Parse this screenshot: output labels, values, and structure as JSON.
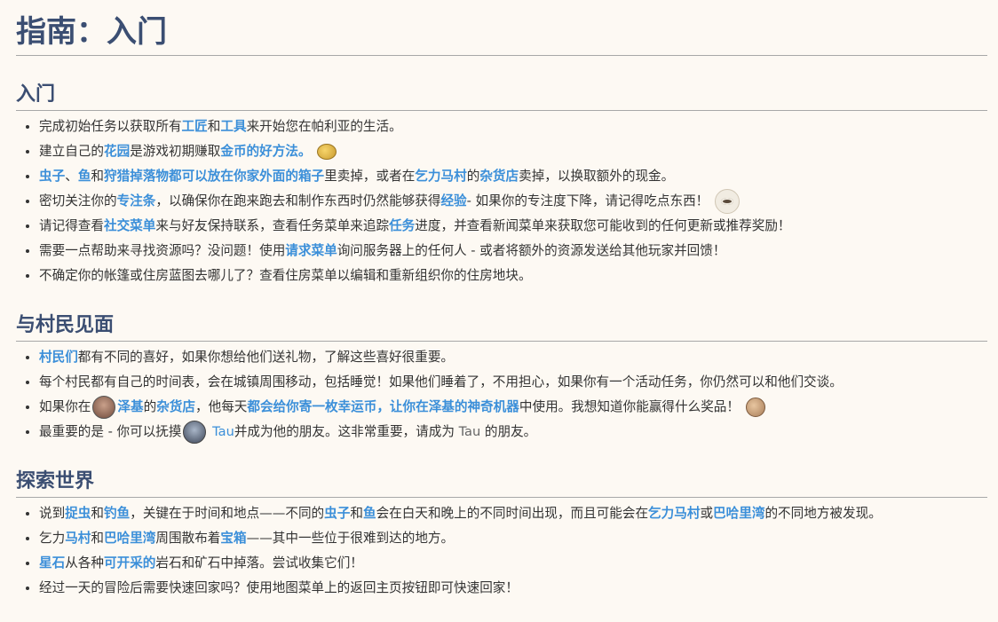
{
  "title": "指南：入门",
  "sections": [
    {
      "heading": "入门",
      "items": [
        [
          "完成初始任务以获取所有",
          "工匠",
          "和",
          "工具",
          "来开始您在帕利亚的生活。"
        ],
        [
          "建立自己的",
          "花园",
          "是游戏初期赚取",
          "金币的好方法。"
        ],
        [
          "虫子",
          "、",
          "鱼",
          "和",
          "狩猎掉落物都可以放在你家外面的箱子",
          "里卖掉，或者在",
          "乞力马村",
          "的",
          "杂货店",
          "卖掉，以换取额外的现金。"
        ],
        [
          "密切关注你的",
          "专注条",
          "，以确保你在跑来跑去和制作东西时仍然能够获得",
          "经验",
          "- 如果你的专注度下降，请记得吃点东西！"
        ],
        [
          "请记得查看",
          "社交菜单",
          "来与好友保持联系，查看任务菜单来追踪",
          "任务",
          "进度，并查看新闻菜单来获取您可能收到的任何更新或推荐奖励！"
        ],
        [
          "需要一点帮助来寻找资源吗？没问题！使用",
          "请求菜单",
          "询问服务器上的任何人 - 或者将额外的资源发送给其他玩家并回馈！"
        ],
        [
          "不确定你的帐篷或住房蓝图去哪儿了？查看住房菜单以编辑和重新组织你的住房地块。"
        ]
      ]
    },
    {
      "heading": "与村民见面",
      "items": [
        [
          "村民们",
          "都有不同的喜好，如果你想给他们送礼物，了解这些喜好很重要。"
        ],
        [
          "每个村民都有自己的时间表，会在城镇周围移动，包括睡觉！如果他们睡着了，不用担心，如果你有一个活动任务，你仍然可以和他们交谈。"
        ],
        [
          "如果你在",
          "泽基",
          "的",
          "杂货店",
          "，他每天",
          "都会给你寄一枚幸运币，让你在泽基的神奇机器",
          "中使用。我想知道你能赢得什么奖品！"
        ],
        [
          "最重要的是 - 你可以抚摸",
          "Tau",
          "并成为他的朋友。这非常重要，请成为 ",
          "Tau",
          " 的朋友。"
        ]
      ]
    },
    {
      "heading": "探索世界",
      "items": [
        [
          "说到",
          "捉虫",
          "和",
          "钓鱼",
          "，关键在于时间和地点——不同的",
          "虫子",
          "和",
          "鱼",
          "会在白天和晚上的不同时间出现，而且可能会在",
          "乞力马村",
          "或",
          "巴哈里湾",
          "的不同地方被发现。"
        ],
        [
          "乞力",
          "马村",
          "和",
          "巴哈里湾",
          "周围散布着",
          "宝箱",
          "——其中一些位于很难到达的地方。"
        ],
        [
          "星石",
          "从各种",
          "可开采的",
          "岩石和矿石中掉落。尝试收集它们！"
        ],
        [
          "经过一天的冒险后需要快速回家吗？使用地图菜单上的返回主页按钮即可快速回家！"
        ]
      ]
    }
  ],
  "icons": {
    "gold_coin": "gold-coin-icon",
    "focus_eye": "focus-eye-icon",
    "zeki_avatar": "zeki-avatar-icon",
    "lucky_coin": "lucky-coin-icon",
    "tau_avatar": "tau-avatar-icon"
  },
  "colors": {
    "heading": "#3b4e72",
    "link": "#3b8fd9",
    "background": "#fdf9f3",
    "text": "#333333"
  }
}
